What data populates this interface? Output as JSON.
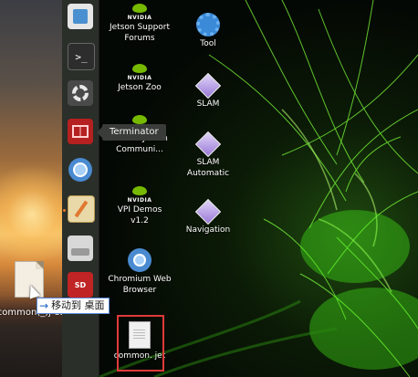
{
  "outer_desktop": {
    "file_label": "common(_)j et",
    "tooltip_label": "移动到 桌面",
    "tooltip_arrow": "→"
  },
  "dock": {
    "terminal_glyph": ">_",
    "sd_label": "SD",
    "items": [
      {
        "name": "store-icon"
      },
      {
        "name": "terminal-icon"
      },
      {
        "name": "settings-icon"
      },
      {
        "name": "terminator-icon"
      },
      {
        "name": "chromium-icon"
      },
      {
        "name": "text-editor-icon"
      },
      {
        "name": "drive-icon"
      },
      {
        "name": "sd-card-icon"
      }
    ],
    "tooltip": "Terminator"
  },
  "desktop": {
    "nvidia_logo_text": "NVIDIA",
    "icons": [
      {
        "label": "Jetson Support Forums"
      },
      {
        "label": "Jetson Zoo"
      },
      {
        "label": "NVIDIA Jetson Communi..."
      },
      {
        "label": "VPI Demos v1.2"
      },
      {
        "label": "Chromium Web Browser"
      },
      {
        "label": "common. jet"
      },
      {
        "label": "Tool"
      },
      {
        "label": "SLAM"
      },
      {
        "label": "SLAM Automatic"
      },
      {
        "label": "Navigation"
      }
    ]
  },
  "colors": {
    "nvidia_green": "#76b900",
    "highlight": "#e03a3a",
    "dock_bg": "#2a2f2a"
  }
}
